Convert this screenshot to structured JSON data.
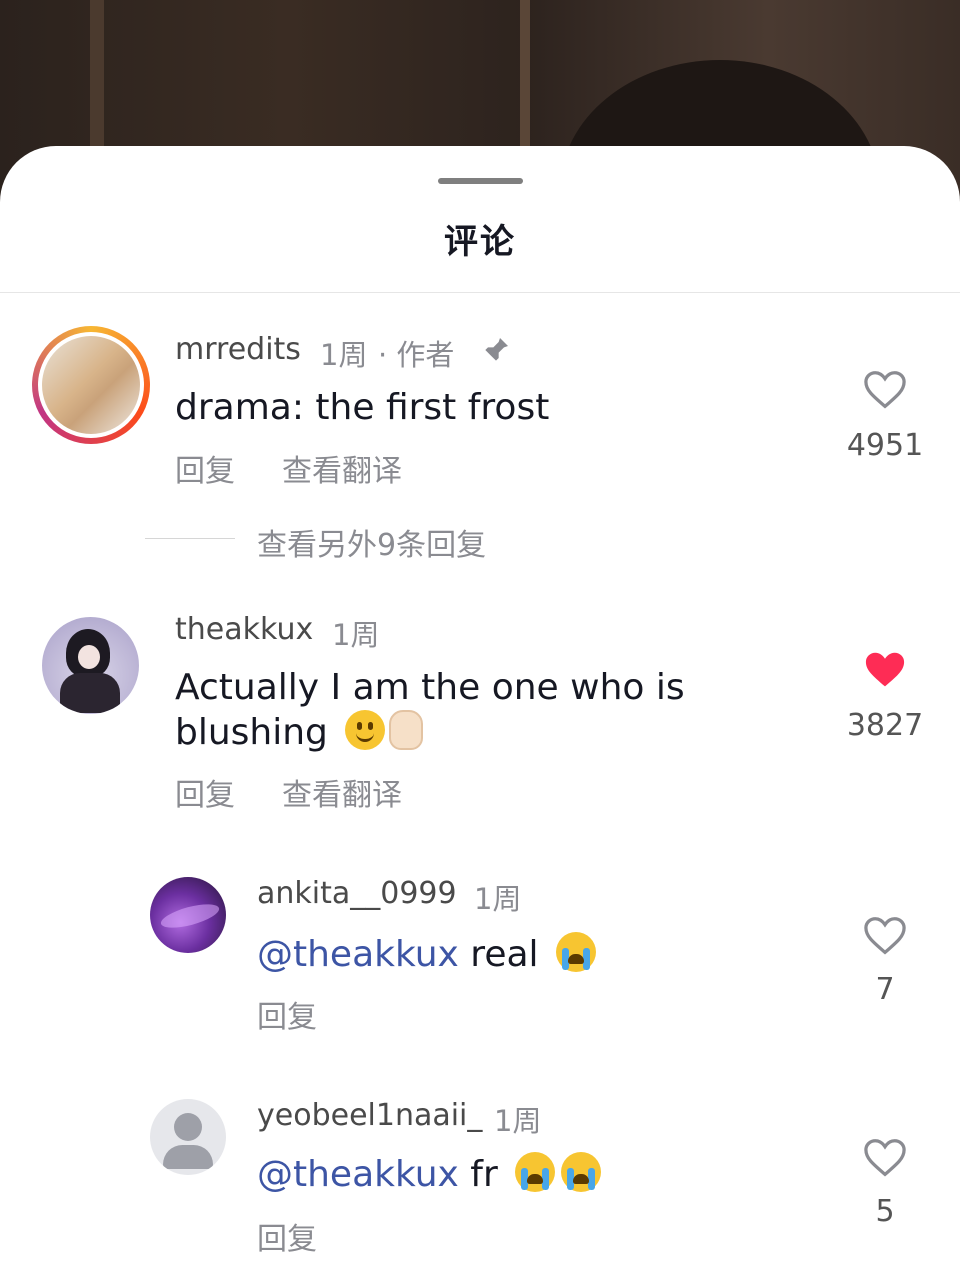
{
  "sheet": {
    "title": "评论"
  },
  "comments": [
    {
      "username": "mrredits",
      "time": "1周",
      "badge": "· 作者",
      "pinned_icon": "pin-icon",
      "text": "drama: the first frost",
      "reply_label": "回复",
      "translate_label": "查看翻译",
      "likes": "4951",
      "liked": false,
      "view_more_replies": "查看另外9条回复"
    },
    {
      "username": "theakkux",
      "time": "1周",
      "text_line1": "Actually I am the one who is",
      "text_line2": "blushing",
      "reply_label": "回复",
      "translate_label": "查看翻译",
      "likes": "3827",
      "liked": true,
      "liked_color": "#fe2c55"
    }
  ],
  "replies": [
    {
      "username": "ankita__0999",
      "time": "1周",
      "mention": "@theakkux",
      "text": " real",
      "reply_label": "回复",
      "likes": "7",
      "liked": false
    },
    {
      "username": "yeobeel1naaii_",
      "time": "1周",
      "mention": "@theakkux",
      "text": " fr",
      "reply_label": "回复",
      "likes": "5",
      "liked": false
    }
  ],
  "colors": {
    "mention": "#3d55a5",
    "like_red": "#fe2c55",
    "avatar_ring": "#e8b84a"
  }
}
